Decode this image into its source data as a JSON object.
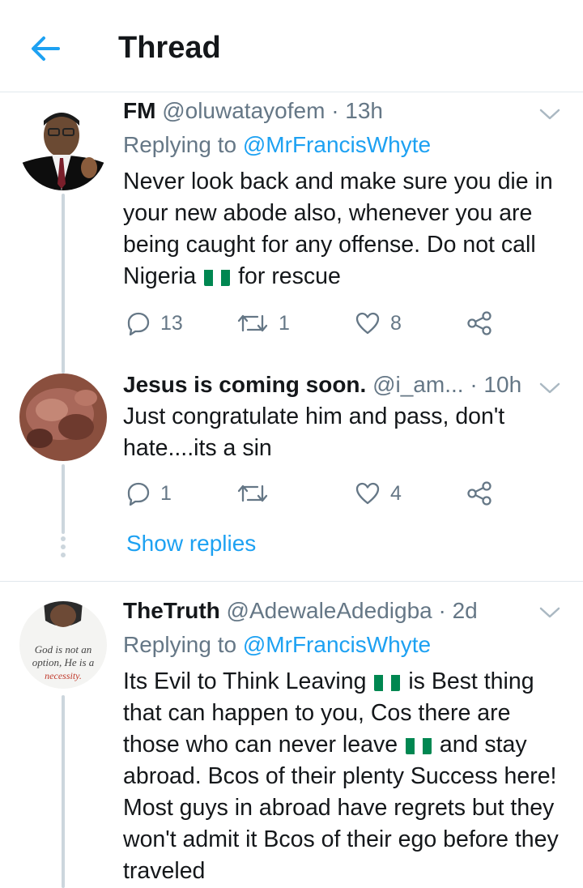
{
  "header": {
    "title": "Thread",
    "back_icon": "arrow-left-icon"
  },
  "tweets": [
    {
      "name": "FM",
      "handle": "@oluwatayofem",
      "time": "· 13h",
      "replying_prefix": "Replying to",
      "replying_to": "@MrFrancisWhyte",
      "text_parts": [
        "Never look back and make sure you die in your new abode also, whenever you are being caught for any offense. Do not call Nigeria",
        "for rescue"
      ],
      "replies": "13",
      "retweets": "1",
      "likes": "8"
    },
    {
      "name": "Jesus is coming soon.",
      "handle": "@i_am...",
      "time": "· 10h",
      "text": "Just congratulate him and pass, don't hate....its a sin",
      "replies": "1",
      "retweets": "",
      "likes": "4"
    },
    {
      "name": "TheTruth",
      "handle": "@AdewaleAdedigba",
      "time": "· 2d",
      "replying_prefix": "Replying to",
      "replying_to": "@MrFrancisWhyte",
      "text_parts": [
        "Its Evil to Think Leaving",
        "is Best thing that can happen to you, Cos there are those who can never leave",
        "and stay abroad. Bcos of their plenty Success here! Most guys in abroad have regrets but they won't admit it Bcos of their ego before they traveled"
      ],
      "avatar_text": [
        "God is not an",
        "option, He is a",
        "necessity."
      ]
    }
  ],
  "show_replies": "Show replies",
  "colors": {
    "accent": "#1da1f2",
    "secondary_text": "#657786",
    "thread_line": "#ccd6dd",
    "flag_green": "#008751"
  }
}
